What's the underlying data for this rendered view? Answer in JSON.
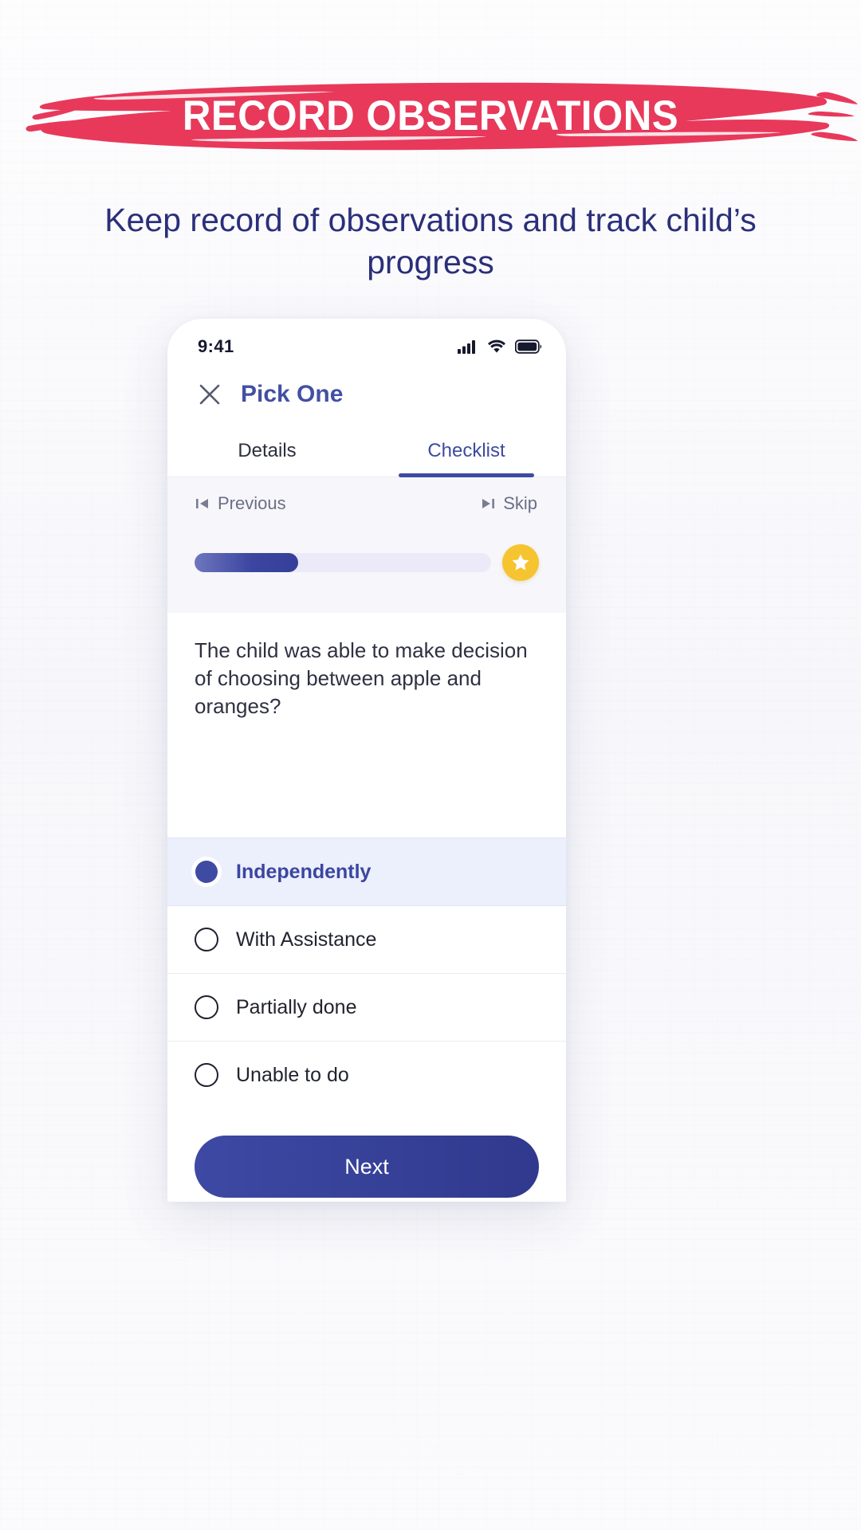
{
  "banner": {
    "title": "RECORD OBSERVATIONS",
    "color": "#e8395b"
  },
  "subtitle": "Keep record of observations and track child’s progress",
  "subtitle_color": "#2b2f7a",
  "phone": {
    "statusbar": {
      "time": "9:41",
      "icons": [
        "signal-icon",
        "wifi-icon",
        "battery-icon"
      ]
    },
    "header": {
      "close_icon": "close-icon",
      "title": "Pick One"
    },
    "tabs": [
      {
        "label": "Details",
        "active": false
      },
      {
        "label": "Checklist",
        "active": true
      }
    ],
    "nav": {
      "previous_label": "Previous",
      "previous_icon": "skip-to-start-icon",
      "skip_label": "Skip",
      "skip_icon": "skip-to-end-icon"
    },
    "progress": {
      "percent": 35,
      "fill_color": "#3b46a0",
      "track_color": "#eceaf8",
      "badge_icon": "star-icon",
      "badge_color": "#f5c430"
    },
    "question": "The child was able to make decision of choosing between apple and oranges?",
    "options": [
      {
        "label": "Independently",
        "selected": true
      },
      {
        "label": "With Assistance",
        "selected": false
      },
      {
        "label": "Partially done",
        "selected": false
      },
      {
        "label": "Unable to do",
        "selected": false
      }
    ],
    "next_label": "Next"
  }
}
